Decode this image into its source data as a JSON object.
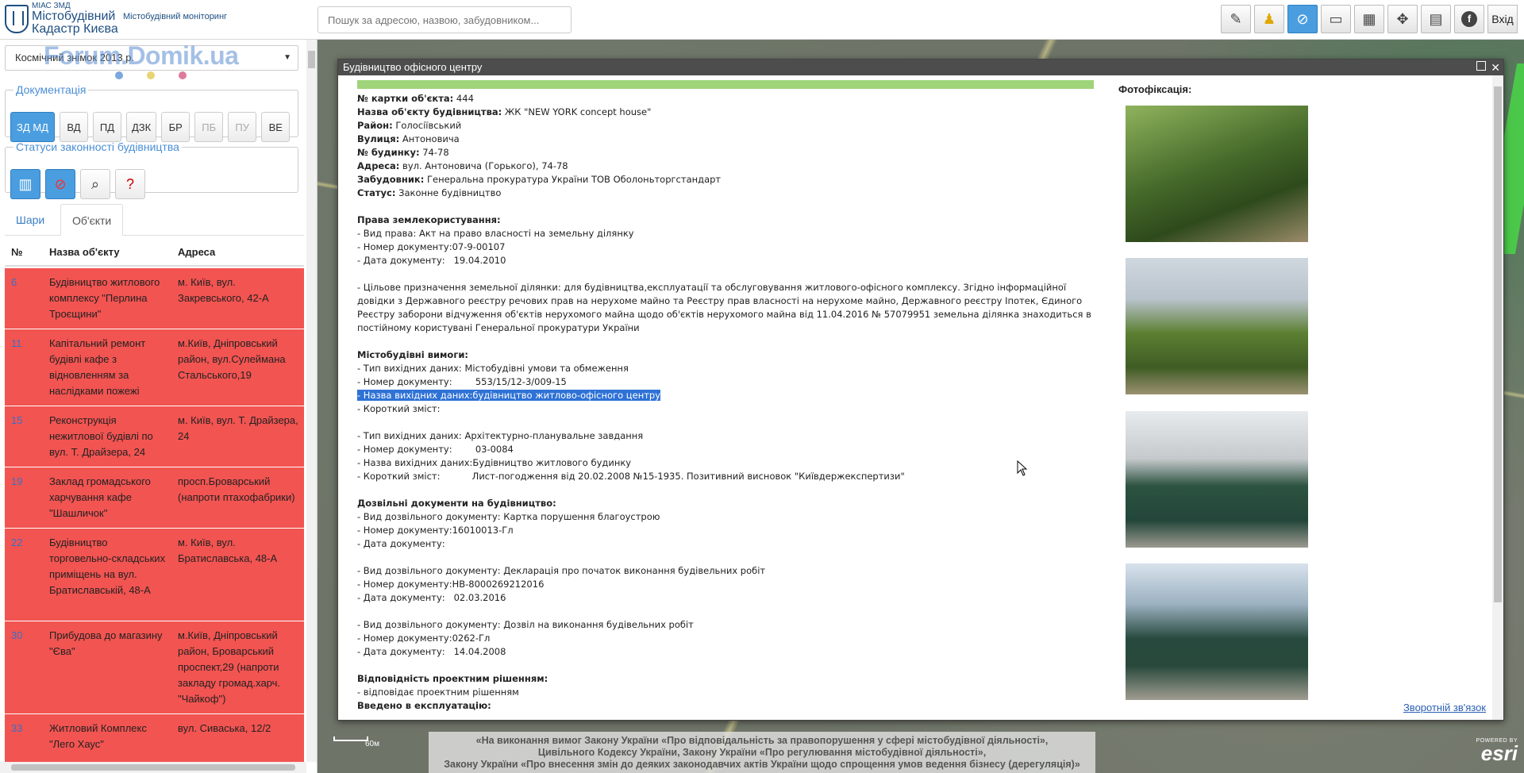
{
  "header": {
    "logo_small": "МІАС ЗМД",
    "logo_line1": "Містобудівний",
    "logo_line2": "Кадастр Києва",
    "subtitle": "Містобудівний моніторинг",
    "search_placeholder": "Пошук за адресою, назвою, забудовником...",
    "login_label": "Вхід",
    "toolbar_icons": [
      "edit-icon",
      "person-icon",
      "compass-icon",
      "ruler-icon",
      "measure-icon",
      "move-icon",
      "print-icon",
      "facebook-icon"
    ]
  },
  "sidebar": {
    "basemap": "Космічний знімок 2013 р.",
    "watermark": "Forum.Domik.ua",
    "docs_legend": "Документація",
    "doc_buttons": [
      "ЗД МД",
      "ВД",
      "ПД",
      "ДЗК",
      "БР",
      "ПБ",
      "ПУ",
      "ВЕ"
    ],
    "status_legend": "Статуси законності будівництва",
    "tabs": [
      "Шари",
      "Об'єкти"
    ],
    "columns": [
      "№",
      "Назва об'єкту",
      "Адреса"
    ],
    "rows": [
      {
        "num": "6",
        "name": "Будівництво житлового комплексу \"Перлина Троєщини\"",
        "addr": "м. Київ, вул. Закревського, 42-А"
      },
      {
        "num": "11",
        "name": "Капітальний ремонт будівлі кафе з відновленням за наслідками пожежі",
        "addr": "м.Київ, Дніпровський район, вул.Сулеймана Стальського,19"
      },
      {
        "num": "15",
        "name": "Реконструкція нежитлової будівлі по вул. Т. Драйзера, 24",
        "addr": "м. Київ, вул. Т. Драйзера, 24"
      },
      {
        "num": "19",
        "name": "Заклад громадського харчування кафе \"Шашличок\"",
        "addr": "просп.Броварський (напроти птахофабрики)"
      },
      {
        "num": "22",
        "name": "Будівництво торговельно-складських приміщень на вул. Братиславській, 48-А",
        "addr": "м. Київ, вул. Братиславська, 48-А"
      },
      {
        "num": "30",
        "name": "Прибудова до магазину \"Єва\"",
        "addr": "м.Київ, Дніпровський район, Броварський проспект,29 (напроти закладу громад.харч. \"Чайкоф\")"
      },
      {
        "num": "33",
        "name": "Житловий Комплекс \"Лего Хаус\"",
        "addr": "вул. Сиваська, 12/2"
      }
    ]
  },
  "popup": {
    "title": "Будівництво офісного центру",
    "l_card": "№ картки об'єкта:",
    "v_card": " 444",
    "l_name": "Назва об'єкту будівництва:",
    "v_name": " ЖК \"NEW YORK concept house\"",
    "l_district": "Район:",
    "v_district": " Голосіївський",
    "l_street": "Вулиця:",
    "v_street": " Антоновича",
    "l_house": "№ будинку:",
    "v_house": " 74-78",
    "l_address": "Адреса:",
    "v_address": " вул. Антоновича (Горького), 74-78",
    "l_developer": "Забудовник:",
    "v_developer": " Генеральна прокуратура України ТОВ Оболоньторгстандарт",
    "l_status": "Статус:",
    "v_status": " Законне будівництво",
    "land_heading": "Права землекористування:",
    "land_right_type": "- Вид права: Акт на право власності на земельну ділянку",
    "land_doc_num": "- Номер документу:07-9-00107",
    "land_doc_date": "- Дата документу:   19.04.2010",
    "land_purpose": "- Цільове призначення земельної ділянки: для будівництва,експлуатації та обслуговування житлового-офісного комплексу. Згідно інформаційної довідки з Державного реєстру речових прав на нерухоме майно та Реєстру прав власності на нерухоме майно, Державного реєстру Іпотек, Єдиного Реєстру заборони відчуження об'єктів нерухомого майна щодо об'єктів нерухомого майна від 11.04.2016 № 57079951 земельна ділянка знаходиться в постійному користувані Генеральної прокуратури України",
    "urban_heading": "Містобудівні вимоги:",
    "u1_type": "- Тип вихідних даних: Містобудівні умови та обмеження",
    "u1_num": "- Номер документу:        553/15/12-3/009-15",
    "u1_name": "- Назва вихідних даних:будівництво житлово-офісного центру",
    "u1_summary": "- Короткий зміст:",
    "u2_type": "- Тип вихідних даних: Архітектурно-планувальне завдання",
    "u2_num": "- Номер документу:        03-0084",
    "u2_name": "- Назва вихідних даних:Будівництво житлового будинку",
    "u2_summary": "- Короткий зміст:           Лист-погодження від 20.02.2008 №15-1935. Позитивний висновок \"Київдержекспертизи\"",
    "permit_heading": "Дозвільні документи на будівництво:",
    "p1_type": "- Вид дозвільного документу: Картка порушення благоустрою",
    "p1_num": "- Номер документу:16010013-Гл",
    "p1_date": "- Дата документу:",
    "p2_type": "- Вид дозвільного документу: Декларація про початок виконання будівельних робіт",
    "p2_num": "- Номер документу:НВ-8000269212016",
    "p2_date": "- Дата документу:   02.03.2016",
    "p3_type": "- Вид дозвільного документу: Дозвіл на виконання будівельних робіт",
    "p3_num": "- Номер документу:0262-Гл",
    "p3_date": "- Дата документу:   14.04.2008",
    "compliance_heading": "Відповідність проектним рішенням:",
    "compliance_value": "- відповідає проектним рішенням",
    "commission_heading": "Введено в експлуатацію:",
    "photo_heading": "Фотофіксація:",
    "feedback": "Зворотній зв'язок"
  },
  "map": {
    "scale_label": "60м",
    "legal_notice_1": "«На виконання вимог Закону України «Про відповідальність за правопорушення у сфері містобудівної діяльності»,",
    "legal_notice_2": "Цивільного Кодексу України, Закону України «Про регулювання містобудівної діяльності»,",
    "legal_notice_3": "Закону України «Про внесення змін до деяких законодавчих актів України щодо спрощення умов ведення бізнесу (дерегуляція)»",
    "esri_small": "POWERED BY",
    "esri_brand": "esri"
  }
}
